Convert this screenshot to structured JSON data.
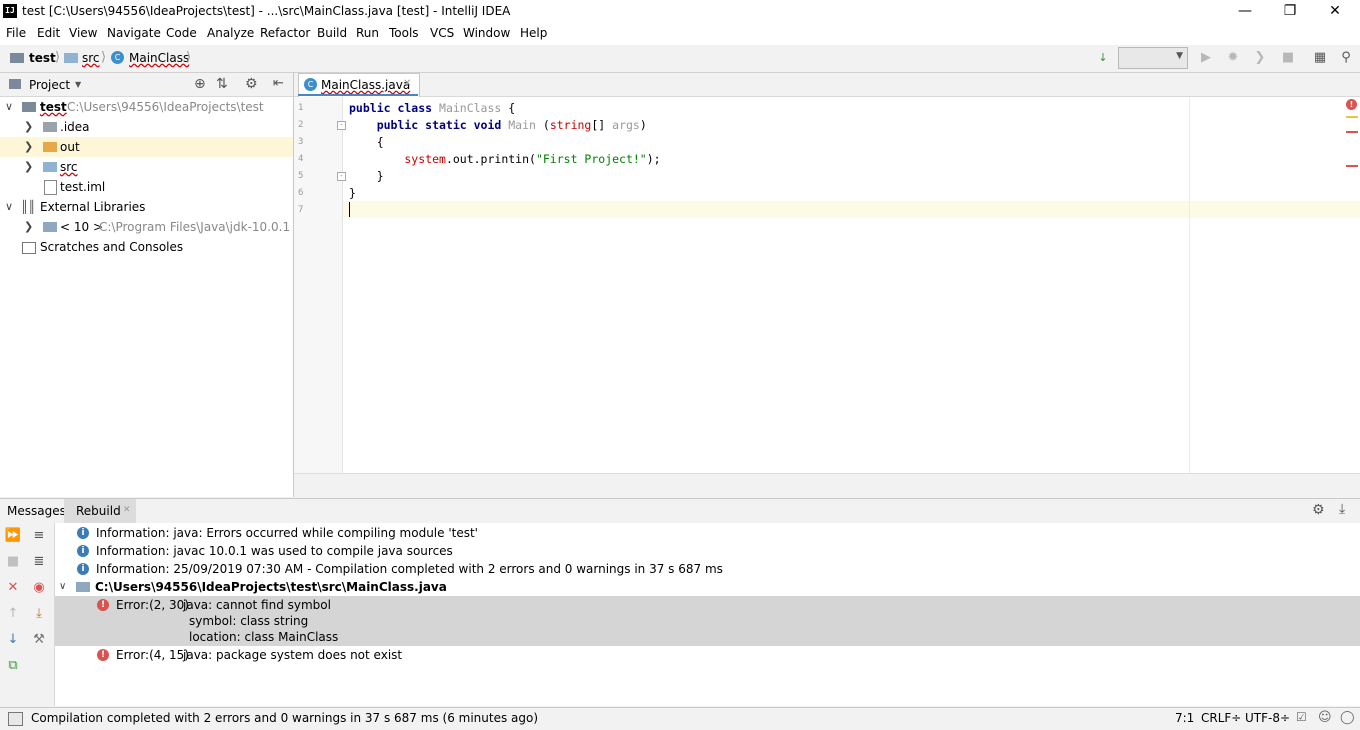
{
  "window": {
    "title": "test [C:\\Users\\94556\\IdeaProjects\\test] - ...\\src\\MainClass.java [test] - IntelliJ IDEA",
    "app_icon_label": "IJ"
  },
  "menu": [
    "File",
    "Edit",
    "View",
    "Navigate",
    "Code",
    "Analyze",
    "Refactor",
    "Build",
    "Run",
    "Tools",
    "VCS",
    "Window",
    "Help"
  ],
  "breadcrumb": {
    "project": "test",
    "folder": "src",
    "file": "MainClass"
  },
  "project_panel": {
    "title": "Project",
    "tree": [
      {
        "label": "test",
        "detail": "C:\\Users\\94556\\IdeaProjects\\test"
      },
      {
        "label": ".idea"
      },
      {
        "label": "out"
      },
      {
        "label": "src"
      },
      {
        "label": "test.iml"
      },
      {
        "label": "External Libraries"
      },
      {
        "label": "< 10 >",
        "detail": "C:\\Program Files\\Java\\jdk-10.0.1"
      },
      {
        "label": "Scratches and Consoles"
      }
    ]
  },
  "editor": {
    "tab_label": "MainClass.java",
    "line_numbers": [
      "1",
      "2",
      "3",
      "4",
      "5",
      "6",
      "7"
    ],
    "code": {
      "l1_kw": "public class ",
      "l1_name": "MainClass",
      "l1_rest": " {",
      "l2_kw": "    public static void ",
      "l2_name": "Main",
      "l2_open": " (",
      "l2_type": "string",
      "l2_rest": "[] ",
      "l2_arg": "args",
      "l2_close": ")",
      "l3": "    {",
      "l4_err": "        system",
      "l4_mid": ".out.printin(",
      "l4_str": "\"First Project!\"",
      "l4_end": ");",
      "l5": "    }",
      "l6": "}"
    }
  },
  "messages": {
    "header_label": "Messages:",
    "tab_label": "Rebuild",
    "rows": [
      {
        "text": "Information: java: Errors occurred while compiling module 'test'"
      },
      {
        "text": "Information: javac 10.0.1 was used to compile java sources"
      },
      {
        "text": "Information: 25/09/2019 07:30 AM - Compilation completed with 2 errors and 0 warnings in 37 s 687 ms"
      },
      {
        "text": "C:\\Users\\94556\\IdeaProjects\\test\\src\\MainClass.java"
      },
      {
        "prefix": "Error:(2, 30)",
        "text": "java: cannot find symbol"
      },
      {
        "text": "symbol:   class string"
      },
      {
        "text": "location: class MainClass"
      },
      {
        "prefix": "Error:(4, 15)",
        "text": "java: package system does not exist"
      }
    ]
  },
  "status": {
    "message": "Compilation completed with 2 errors and 0 warnings in 37 s 687 ms (6 minutes ago)",
    "position": "7:1",
    "line_separator": "CRLF÷",
    "encoding": "UTF-8÷"
  },
  "colors": {
    "error": "#d9534f",
    "info": "#3d7bb6",
    "caret_line": "#fdfae5",
    "selection": "#d5d5d5"
  }
}
